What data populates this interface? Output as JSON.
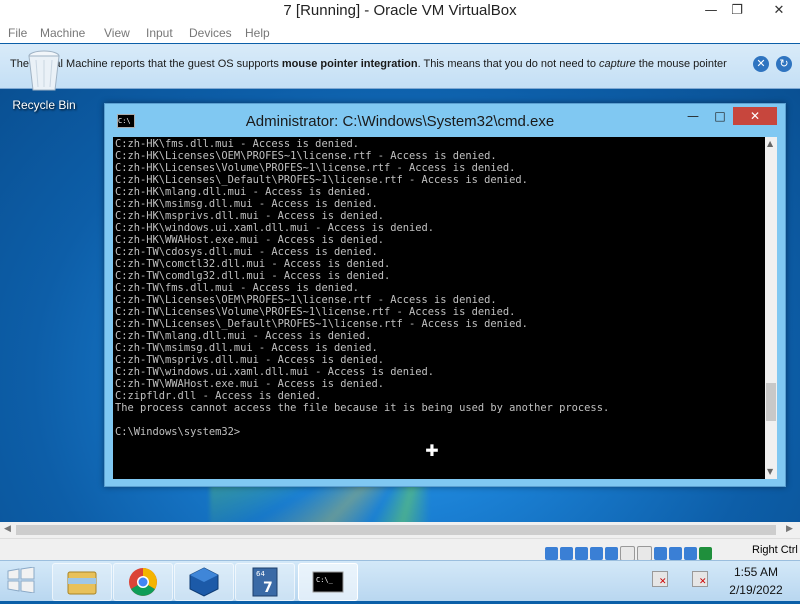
{
  "host": {
    "title": "7 [Running] - Oracle VM VirtualBox",
    "menu": [
      "File",
      "Machine",
      "View",
      "Input",
      "Devices",
      "Help"
    ],
    "host_key": "Right Ctrl"
  },
  "notice": {
    "text_before": "The Virtual Machine reports that the guest OS supports ",
    "text_bold": "mouse pointer integration",
    "text_mid": ". This means that you do not need to ",
    "text_italic": "capture",
    "text_after": " the mouse pointer"
  },
  "desktop": {
    "recycle_bin_label": "Recycle Bin"
  },
  "cmd": {
    "title": "Administrator: C:\\Windows\\System32\\cmd.exe",
    "icon_text": "C:\\",
    "lines": [
      "C:zh-HK\\fms.dll.mui - Access is denied.",
      "C:zh-HK\\Licenses\\OEM\\PROFES~1\\license.rtf - Access is denied.",
      "C:zh-HK\\Licenses\\Volume\\PROFES~1\\license.rtf - Access is denied.",
      "C:zh-HK\\Licenses\\_Default\\PROFES~1\\license.rtf - Access is denied.",
      "C:zh-HK\\mlang.dll.mui - Access is denied.",
      "C:zh-HK\\msimsg.dll.mui - Access is denied.",
      "C:zh-HK\\msprivs.dll.mui - Access is denied.",
      "C:zh-HK\\windows.ui.xaml.dll.mui - Access is denied.",
      "C:zh-HK\\WWAHost.exe.mui - Access is denied.",
      "C:zh-TW\\cdosys.dll.mui - Access is denied.",
      "C:zh-TW\\comctl32.dll.mui - Access is denied.",
      "C:zh-TW\\comdlg32.dll.mui - Access is denied.",
      "C:zh-TW\\fms.dll.mui - Access is denied.",
      "C:zh-TW\\Licenses\\OEM\\PROFES~1\\license.rtf - Access is denied.",
      "C:zh-TW\\Licenses\\Volume\\PROFES~1\\license.rtf - Access is denied.",
      "C:zh-TW\\Licenses\\_Default\\PROFES~1\\license.rtf - Access is denied.",
      "C:zh-TW\\mlang.dll.mui - Access is denied.",
      "C:zh-TW\\msimsg.dll.mui - Access is denied.",
      "C:zh-TW\\msprivs.dll.mui - Access is denied.",
      "C:zh-TW\\windows.ui.xaml.dll.mui - Access is denied.",
      "C:zh-TW\\WWAHost.exe.mui - Access is denied.",
      "C:zipfldr.dll - Access is denied.",
      "The process cannot access the file because it is being used by another process.",
      "",
      "C:\\Windows\\system32>"
    ]
  },
  "taskbar": {
    "time": "1:55 AM",
    "date": "2/19/2022",
    "apps": [
      "file-explorer",
      "chrome",
      "virtualbox",
      "windows-7-vm",
      "cmd"
    ]
  }
}
